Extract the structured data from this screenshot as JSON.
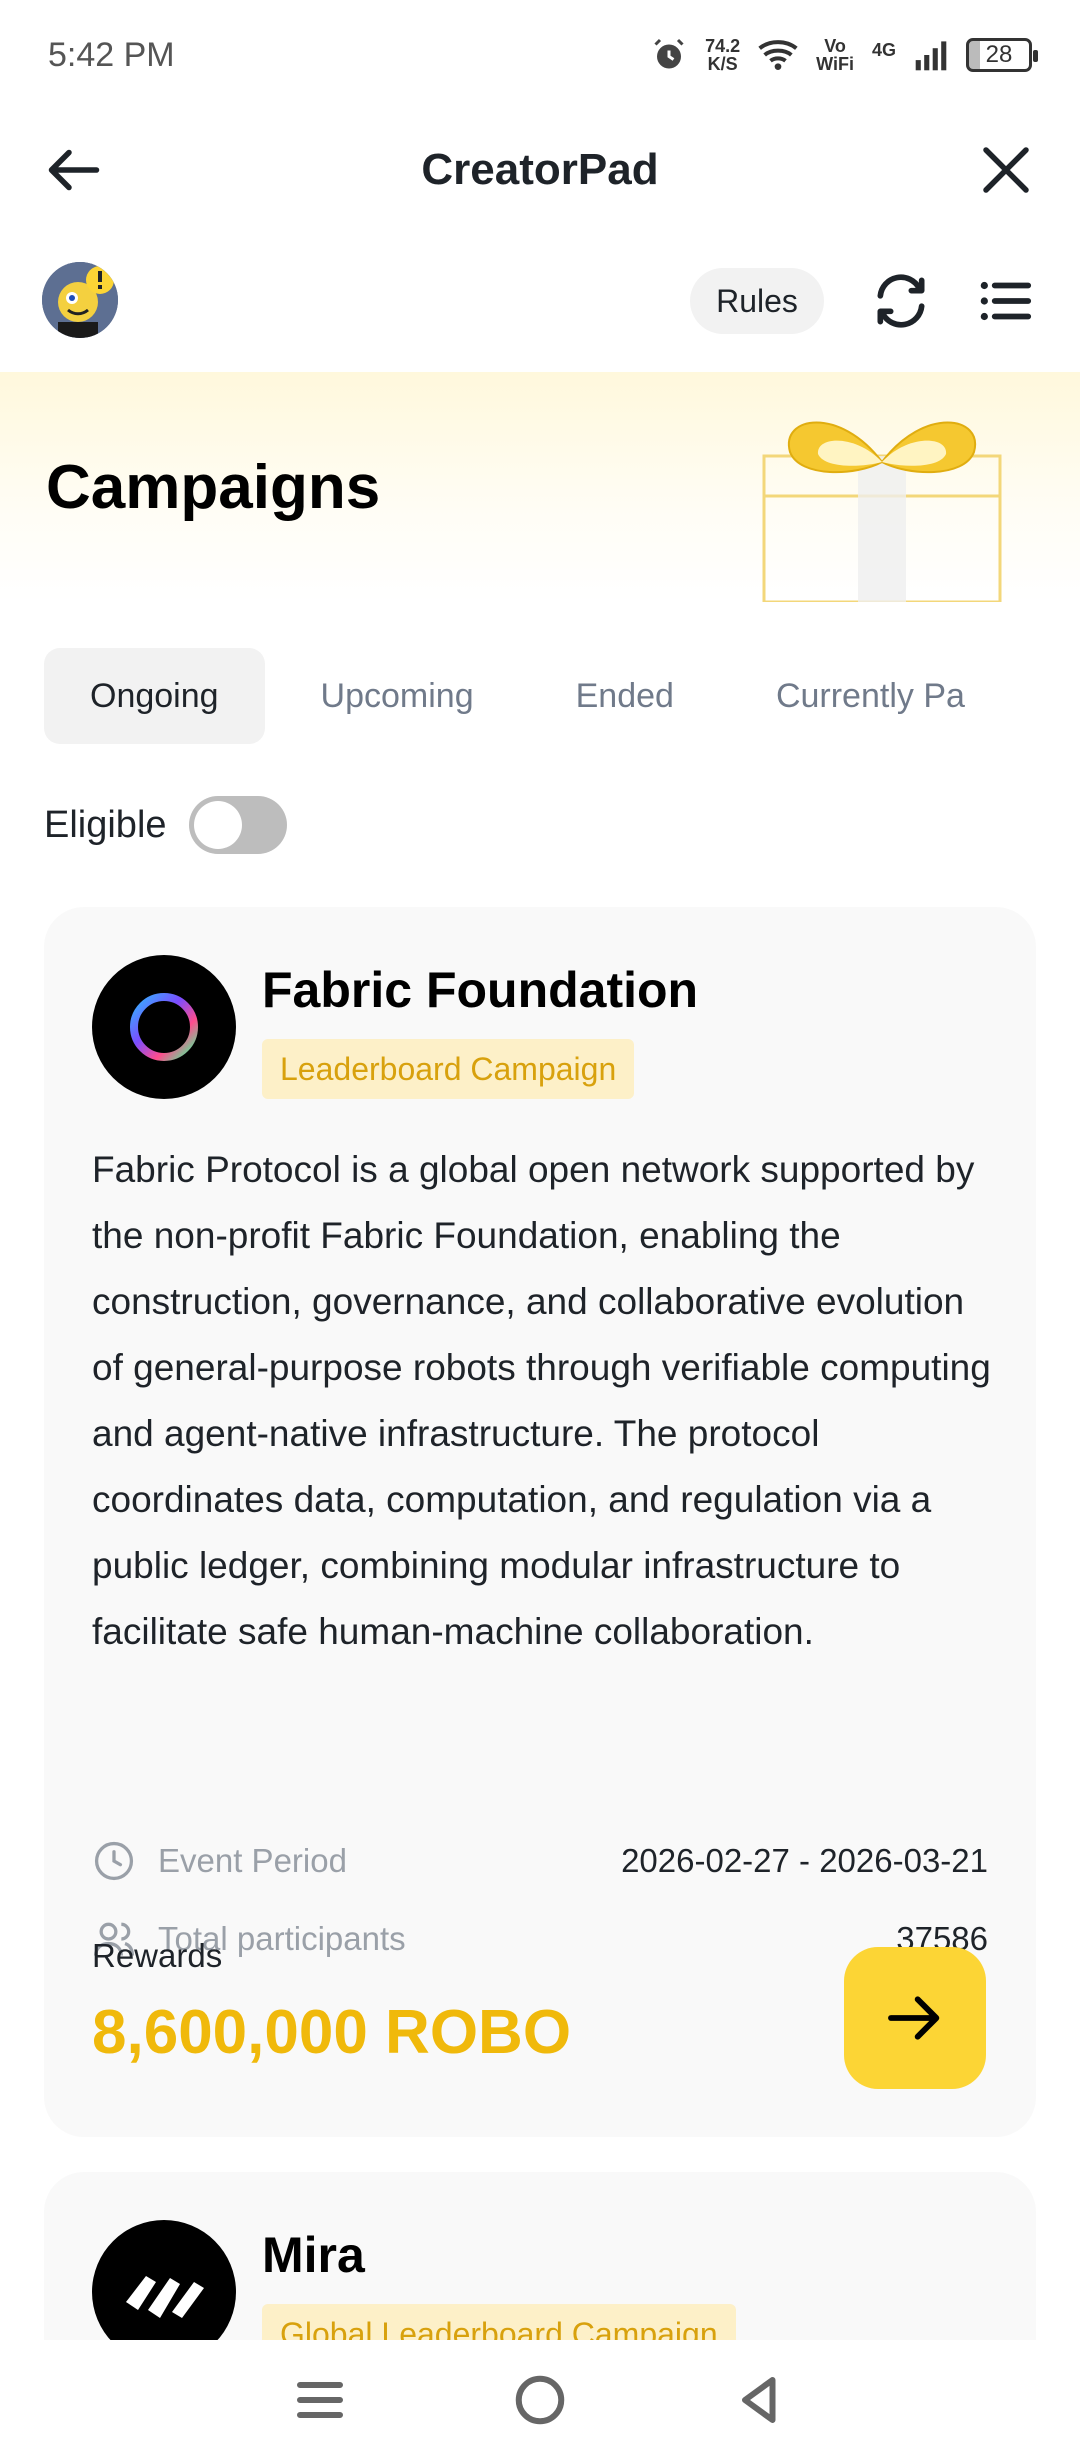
{
  "status_bar": {
    "time": "5:42 PM",
    "net_speed_value": "74.2",
    "net_speed_unit": "K/S",
    "volte_top": "Vo",
    "volte_bottom": "WiFi",
    "network": "4G",
    "battery": "28"
  },
  "appbar": {
    "title": "CreatorPad",
    "back_icon": "arrow-left-icon",
    "close_icon": "close-icon"
  },
  "toolbar": {
    "rules_label": "Rules",
    "refresh_icon": "refresh-icon",
    "list_icon": "list-icon"
  },
  "banner": {
    "title": "Campaigns"
  },
  "tabs": [
    {
      "label": "Ongoing",
      "active": true
    },
    {
      "label": "Upcoming",
      "active": false
    },
    {
      "label": "Ended",
      "active": false
    },
    {
      "label": "Currently Pa",
      "active": false
    }
  ],
  "filter": {
    "eligible_label": "Eligible",
    "eligible_on": false
  },
  "campaigns": [
    {
      "name": "Fabric Foundation",
      "badge": "Leaderboard Campaign",
      "description": "Fabric Protocol is a global open network supported by the non-profit Fabric Foundation, enabling the construction, governance, and collaborative evolution of general-purpose robots through verifiable computing and agent-native infrastructure. The protocol coordinates data, computation, and regulation via a public ledger, combining modular infrastructure to facilitate safe human-machine collaboration.",
      "event_period_label": "Event Period",
      "event_period": "2026-02-27 - 2026-03-21",
      "participants_label": "Total participants",
      "participants": "37586",
      "rewards_label": "Rewards",
      "rewards": "8,600,000 ROBO"
    },
    {
      "name": "Mira",
      "badge": "Global Leaderboard Campaign"
    }
  ],
  "colors": {
    "accent": "#fcd535",
    "reward_text": "#f0b90b",
    "badge_bg": "#fdf0c8",
    "badge_text": "#d8a10d"
  }
}
